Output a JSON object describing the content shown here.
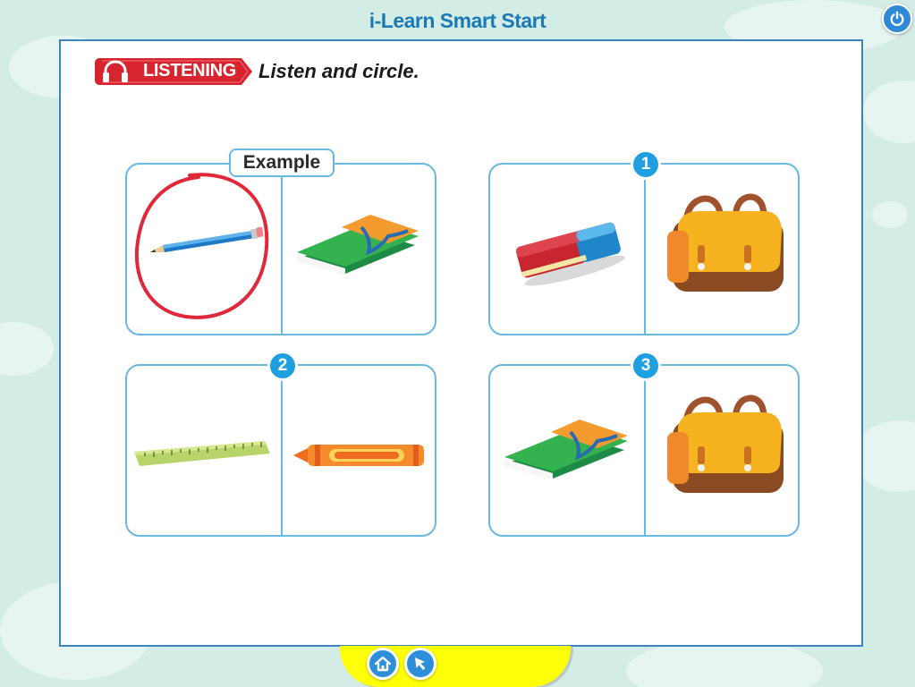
{
  "app": {
    "title": "i-Learn Smart Start"
  },
  "header": {
    "section_label": "LISTENING",
    "section_icon": "headphones-icon",
    "instruction": "Listen and circle."
  },
  "exercise": {
    "example_label": "Example",
    "items": [
      {
        "badge": "",
        "left_image": "pencil",
        "right_image": "book",
        "circled": "left"
      },
      {
        "badge": "1",
        "left_image": "eraser",
        "right_image": "school-bag",
        "circled": ""
      },
      {
        "badge": "2",
        "left_image": "ruler",
        "right_image": "crayon",
        "circled": ""
      },
      {
        "badge": "3",
        "left_image": "book",
        "right_image": "school-bag",
        "circled": ""
      }
    ]
  },
  "nav": {
    "power_icon": "power-icon",
    "home_icon": "home-icon",
    "pointer_icon": "arrow-cursor-icon"
  },
  "colors": {
    "title_blue": "#1b7ab6",
    "card_border": "#69b7e3",
    "badge_blue": "#1e9fe0",
    "listening_red": "#d7242f",
    "circle_red": "#e0283a",
    "tray_yellow": "#ffff08"
  }
}
